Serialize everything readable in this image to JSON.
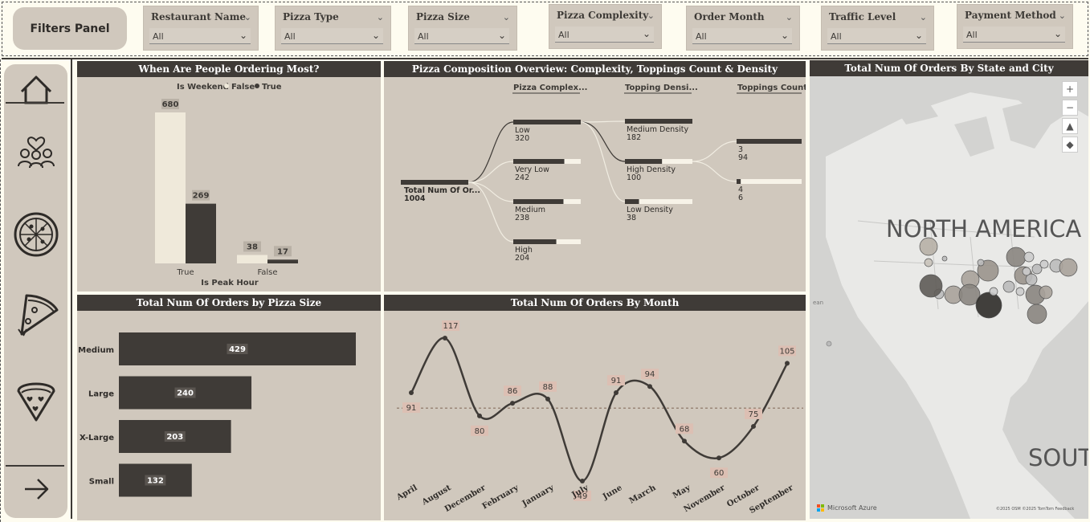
{
  "filters": {
    "panel_label": "Filters Panel",
    "slicers": [
      {
        "label": "Restaurant Name",
        "value": "All"
      },
      {
        "label": "Pizza Type",
        "value": "All"
      },
      {
        "label": "Pizza Size",
        "value": "All"
      },
      {
        "label": "Pizza Complexity",
        "value": "All"
      },
      {
        "label": "Order Month",
        "value": "All"
      },
      {
        "label": "Traffic Level",
        "value": "All"
      },
      {
        "label": "Payment Method",
        "value": "All"
      }
    ]
  },
  "nav": {
    "icons": [
      "home-icon",
      "people-heart-icon",
      "pizza-icon",
      "pizza-slice-icon",
      "pizza-heart-icon",
      "arrow-right-icon"
    ]
  },
  "peak": {
    "title": "When Are People Ordering Most?",
    "legend_title": "Is Weekend",
    "legend_false": "False",
    "legend_true": "True",
    "xlabel": "Is Peak Hour",
    "colors": {
      "false": "#efe9da",
      "true": "#3f3b37"
    }
  },
  "composition": {
    "title": "Pizza Composition Overview: Complexity, Toppings Count & Density",
    "col1": "Pizza Complex...",
    "col2": "Topping Densi...",
    "col3": "Toppings Count",
    "root": {
      "label": "Total Num Of Or...",
      "value": "1004"
    },
    "complexity": [
      {
        "label": "Low",
        "value": "320"
      },
      {
        "label": "Very Low",
        "value": "242"
      },
      {
        "label": "Medium",
        "value": "238"
      },
      {
        "label": "High",
        "value": "204"
      }
    ],
    "density": [
      {
        "label": "Medium Density",
        "value": "182"
      },
      {
        "label": "High Density",
        "value": "100"
      },
      {
        "label": "Low Density",
        "value": "38"
      }
    ],
    "toppings": [
      {
        "label": "3",
        "value": "94"
      },
      {
        "label": "4",
        "value": "6"
      }
    ]
  },
  "map": {
    "title": "Total Num Of Orders By State and City",
    "continent1": "NORTH AMERICA",
    "continent2": "SOUT",
    "ocean_label": "ean",
    "brand": "Microsoft Azure",
    "attribution": "©2025 OSM ©2025 TomTom Feedback",
    "controls": [
      "+",
      "−",
      "▲",
      "◆"
    ]
  },
  "size_chart": {
    "title": "Total Num Of Orders by Pizza Size"
  },
  "month_chart": {
    "title": "Total Num Of Orders By Month"
  },
  "chart_data": [
    {
      "type": "bar",
      "title": "When Are People Ordering Most?",
      "xlabel": "Is Peak Hour",
      "categories": [
        "True",
        "False"
      ],
      "legend_title": "Is Weekend",
      "series": [
        {
          "name": "False",
          "values": [
            680,
            38
          ]
        },
        {
          "name": "True",
          "values": [
            269,
            17
          ]
        }
      ]
    },
    {
      "type": "bar",
      "orientation": "horizontal",
      "title": "Total Num Of Orders by Pizza Size",
      "categories": [
        "Medium",
        "Large",
        "X-Large",
        "Small"
      ],
      "values": [
        429,
        240,
        203,
        132
      ]
    },
    {
      "type": "line",
      "title": "Total Num Of Orders By Month",
      "categories": [
        "April",
        "August",
        "December",
        "February",
        "January",
        "July",
        "June",
        "March",
        "May",
        "November",
        "October",
        "September"
      ],
      "values": [
        91,
        117,
        80,
        86,
        88,
        49,
        91,
        94,
        68,
        60,
        75,
        105
      ]
    }
  ]
}
